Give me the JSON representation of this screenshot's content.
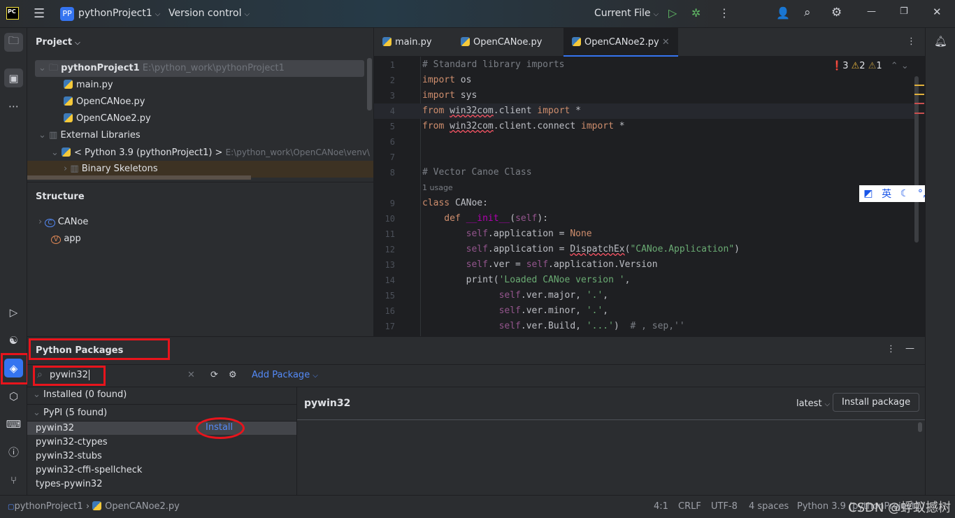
{
  "titlebar": {
    "logo": "PC",
    "project_badge": "PP",
    "project": "pythonProject1",
    "vcs": "Version control",
    "run_config": "Current File"
  },
  "project_panel": {
    "title": "Project",
    "root": {
      "name": "pythonProject1",
      "path": "E:\\python_work\\pythonProject1"
    },
    "files": [
      "main.py",
      "OpenCANoe.py",
      "OpenCANoe2.py"
    ],
    "external": "External Libraries",
    "sdk": "< Python 3.9 (pythonProject1) >",
    "sdk_path": "E:\\python_work\\OpenCANoe\\venv\\",
    "skeletons": "Binary Skeletons"
  },
  "structure": {
    "title": "Structure",
    "items": [
      {
        "badge": "C",
        "label": "CANoe"
      },
      {
        "badge": "V",
        "label": "app"
      }
    ]
  },
  "editor": {
    "tabs": [
      "main.py",
      "OpenCANoe.py",
      "OpenCANoe2.py"
    ],
    "active_tab": 2,
    "inspections": {
      "errors": "3",
      "warnings": "2",
      "weak": "1"
    },
    "lines": [
      {
        "n": "1",
        "t": [
          [
            "# Standard library imports",
            "c"
          ]
        ]
      },
      {
        "n": "2",
        "t": [
          [
            "import",
            "k"
          ],
          [
            " os",
            "n"
          ]
        ]
      },
      {
        "n": "3",
        "t": [
          [
            "import",
            "k"
          ],
          [
            " sys",
            "n"
          ]
        ]
      },
      {
        "n": "4",
        "t": [
          [
            "from",
            "k"
          ],
          [
            " ",
            "n"
          ],
          [
            "win32com",
            "nu"
          ],
          [
            ".client ",
            "n"
          ],
          [
            "import",
            "k"
          ],
          [
            " *",
            "n"
          ]
        ]
      },
      {
        "n": "5",
        "t": [
          [
            "from",
            "k"
          ],
          [
            " ",
            "n"
          ],
          [
            "win32com",
            "nu"
          ],
          [
            ".client.connect ",
            "n"
          ],
          [
            "import",
            "k"
          ],
          [
            " *",
            "n"
          ]
        ]
      },
      {
        "n": "6",
        "t": []
      },
      {
        "n": "7",
        "t": []
      },
      {
        "n": "8",
        "t": [
          [
            "# Vector Canoe Class",
            "c"
          ]
        ]
      },
      {
        "n": "",
        "t": [
          [
            "1 usage",
            "c"
          ]
        ]
      },
      {
        "n": "9",
        "t": [
          [
            "class",
            "k"
          ],
          [
            " CANoe:",
            "n"
          ]
        ]
      },
      {
        "n": "10",
        "t": [
          [
            "    def ",
            "k"
          ],
          [
            "__init__",
            "m"
          ],
          [
            "(",
            "n"
          ],
          [
            "self",
            "sf"
          ],
          [
            "):",
            "n"
          ]
        ]
      },
      {
        "n": "11",
        "t": [
          [
            "        self",
            "sf"
          ],
          [
            ".application = ",
            "n"
          ],
          [
            "None",
            "k"
          ]
        ]
      },
      {
        "n": "12",
        "t": [
          [
            "        self",
            "sf"
          ],
          [
            ".application = ",
            "n"
          ],
          [
            "DispatchEx",
            "nu"
          ],
          [
            "(",
            "n"
          ],
          [
            "\"CANoe.Application\"",
            "s"
          ],
          [
            ")",
            "n"
          ]
        ]
      },
      {
        "n": "13",
        "t": [
          [
            "        self",
            "sf"
          ],
          [
            ".ver = ",
            "n"
          ],
          [
            "self",
            "sf"
          ],
          [
            ".application.Version",
            "n"
          ]
        ]
      },
      {
        "n": "14",
        "t": [
          [
            "        print",
            "n"
          ],
          [
            "(",
            "n"
          ],
          [
            "'Loaded CANoe version '",
            "s"
          ],
          [
            ",",
            "n"
          ]
        ]
      },
      {
        "n": "15",
        "t": [
          [
            "              self",
            "sf"
          ],
          [
            ".ver.major, ",
            "n"
          ],
          [
            "'.'",
            "s"
          ],
          [
            ",",
            "n"
          ]
        ]
      },
      {
        "n": "16",
        "t": [
          [
            "              self",
            "sf"
          ],
          [
            ".ver.minor, ",
            "n"
          ],
          [
            "'.'",
            "s"
          ],
          [
            ",",
            "n"
          ]
        ]
      },
      {
        "n": "17",
        "t": [
          [
            "              self",
            "sf"
          ],
          [
            ".ver.Build, ",
            "n"
          ],
          [
            "'...'",
            "s"
          ],
          [
            ")  ",
            "n"
          ],
          [
            "# , sep,''",
            "c"
          ]
        ]
      }
    ]
  },
  "ime": {
    "lang": "英"
  },
  "packages": {
    "title": "Python Packages",
    "search_value": "pywin32",
    "add_package": "Add Package",
    "installed_group": "Installed (0 found)",
    "pypi_group": "PyPI (5 found)",
    "results": [
      "pywin32",
      "pywin32-ctypes",
      "pywin32-stubs",
      "pywin32-cffi-spellcheck",
      "types-pywin32"
    ],
    "install_label": "Install",
    "detail_title": "pywin32",
    "version": "latest",
    "install_button": "Install package"
  },
  "statusbar": {
    "crumb_project": "pythonProject1",
    "crumb_file": "OpenCANoe2.py",
    "position": "4:1",
    "line_sep": "CRLF",
    "encoding": "UTF-8",
    "indent": "4 spaces",
    "interpreter": "Python 3.9 (pythonProject1)",
    "watermark": "CSDN @蜉蚁撼树"
  },
  "colors": {
    "accent": "#3574f0",
    "annotation": "#e8141c"
  }
}
